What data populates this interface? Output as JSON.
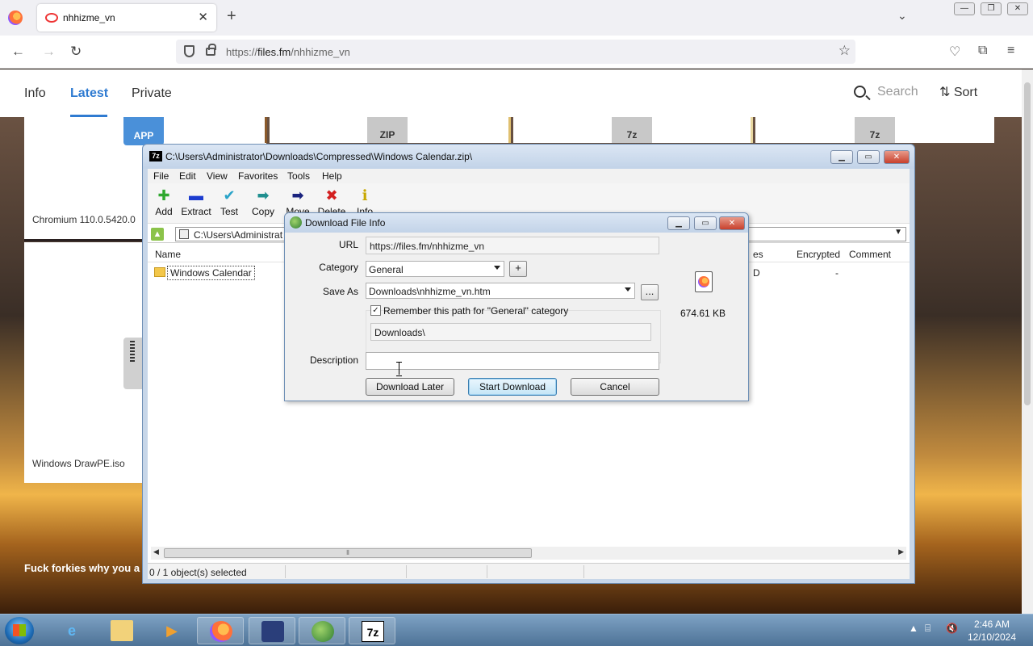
{
  "browser": {
    "tab_title": "nhhizme_vn",
    "tab_close": "✕",
    "new_tab": "+",
    "url_prefix": "https://",
    "url_host": "files.fm",
    "url_path": "/nhhizme_vn",
    "window_controls": [
      "—",
      "❐",
      "✕"
    ]
  },
  "site": {
    "tabs": [
      "Info",
      "Latest",
      "Private"
    ],
    "active_tab": "Latest",
    "search_label": "Search",
    "sort_label": "Sort",
    "thumb_labels": [
      "APP",
      "ZIP",
      "7z",
      "7z"
    ],
    "card_labels": [
      "Chromium 110.0.5420.0",
      "Windows DrawPE.iso"
    ],
    "post_text": "Fuck forkies why you a"
  },
  "sevenzip": {
    "title": "C:\\Users\\Administrator\\Downloads\\Compressed\\Windows Calendar.zip\\",
    "menu": [
      "File",
      "Edit",
      "View",
      "Favorites",
      "Tools",
      "Help"
    ],
    "tools": [
      {
        "label": "Add",
        "glyph": "✚",
        "color": "#2fa82f"
      },
      {
        "label": "Extract",
        "glyph": "▬",
        "color": "#1c3ccf"
      },
      {
        "label": "Test",
        "glyph": "✔",
        "color": "#29a3c8"
      },
      {
        "label": "Copy",
        "glyph": "➡",
        "color": "#1f8f8f"
      },
      {
        "label": "Move",
        "glyph": "➡",
        "color": "#1a237e"
      },
      {
        "label": "Delete",
        "glyph": "✖",
        "color": "#d32020"
      },
      {
        "label": "Info",
        "glyph": "ℹ",
        "color": "#c8a800"
      }
    ],
    "address": "C:\\Users\\Administrat",
    "columns": [
      "Name",
      "es",
      "Encrypted",
      "Comment"
    ],
    "rows": [
      {
        "name": "Windows Calendar",
        "attr": "D",
        "encrypted": "-"
      }
    ],
    "status": "0 / 1 object(s) selected",
    "scroll_grip": "⦀"
  },
  "idm": {
    "title": "Download File Info",
    "labels": {
      "url": "URL",
      "category": "Category",
      "save_as": "Save As",
      "description": "Description"
    },
    "url_value": "https://files.fm/nhhizme_vn",
    "category_value": "General",
    "save_as_value": "Downloads\\nhhizme_vn.htm",
    "remember_text": "Remember this path for \"General\" category",
    "remember_checked": "✓",
    "path_value": "Downloads\\",
    "description_value": "",
    "add_button": "+",
    "browse_button": "...",
    "file_size": "674.61  KB",
    "buttons": {
      "later": "Download Later",
      "start": "Start Download",
      "cancel": "Cancel"
    }
  },
  "taskbar": {
    "time": "2:46 AM",
    "date": "12/10/2024",
    "sevenzip_icon": "7z",
    "tray_up": "▲"
  }
}
